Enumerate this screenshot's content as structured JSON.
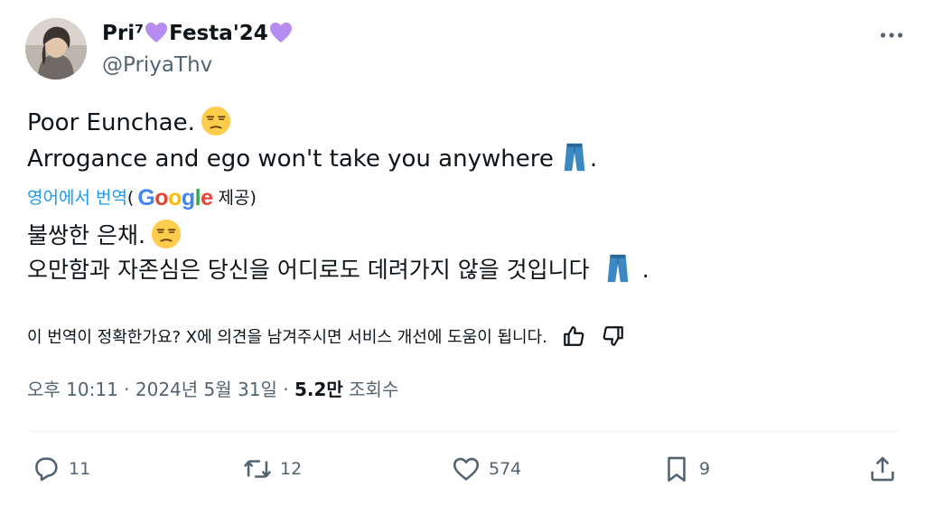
{
  "header": {
    "name_part1": "Pri⁷",
    "name_part2": "Festa'24",
    "handle": "@PriyaThv"
  },
  "tweet": {
    "line1": "Poor Eunchae.",
    "line2": "Arrogance and ego won't take you anywhere",
    "line2_end": "."
  },
  "translation": {
    "translate_link": "영어에서 번역",
    "paren_open": "(",
    "google": [
      "G",
      "o",
      "o",
      "g",
      "l",
      "e"
    ],
    "provided": "제공)",
    "line1": "불쌍한 은채.",
    "line2": "오만함과 자존심은 당신을 어디로도 데려가지 않을 것입니다",
    "line2_end": "."
  },
  "feedback": {
    "question": "이 번역이 정확한가요? X에 의견을 남겨주시면 서비스 개선에 도움이 됩니다."
  },
  "meta": {
    "time": "오후 10:11",
    "sep1": " · ",
    "date": "2024년 5월 31일",
    "sep2": " · ",
    "views_count": "5.2만",
    "views_label": " 조회수"
  },
  "actions": {
    "replies": "11",
    "reposts": "12",
    "likes": "574",
    "bookmarks": "9"
  },
  "colors": {
    "text": "#0f1419",
    "secondary": "#536471",
    "link": "#1d9bf0",
    "heart": "#b78cf0",
    "google_blue": "#4285f4",
    "google_red": "#ea4335",
    "google_yellow": "#fbbc05",
    "google_green": "#34a853"
  },
  "icons": [
    "more-icon",
    "unamused-face-emoji",
    "jeans-emoji",
    "purple-heart-emoji",
    "thumbs-up-icon",
    "thumbs-down-icon",
    "reply-icon",
    "repost-icon",
    "like-icon",
    "bookmark-icon",
    "share-icon"
  ]
}
